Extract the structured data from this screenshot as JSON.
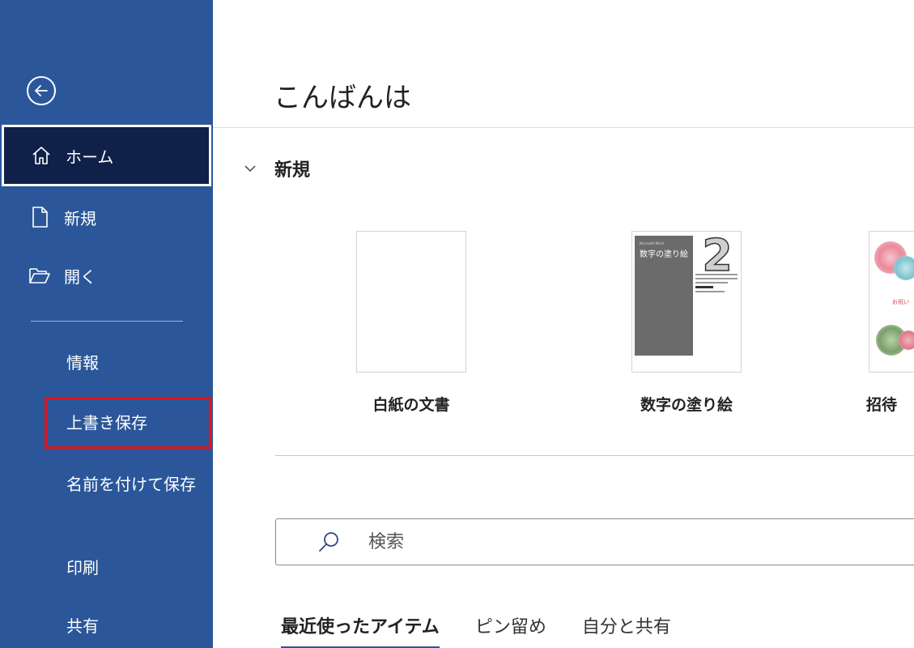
{
  "sidebar": {
    "nav": {
      "home": "ホーム",
      "new": "新規",
      "open": "開く"
    },
    "items": {
      "info": "情報",
      "save": "上書き保存",
      "saveas": "名前を付けて保存",
      "print": "印刷",
      "share": "共有"
    }
  },
  "main": {
    "greeting": "こんばんは",
    "section_new": "新規",
    "templates": {
      "blank": "白紙の文書",
      "coloring": "数字の塗り絵",
      "coloring_thumb_small": "Microsoft Word",
      "coloring_thumb_title": "数字の塗り絵",
      "coloring_thumb_number": "2",
      "invite": "招待",
      "invite_thumb_text": "お祝い"
    },
    "search": {
      "placeholder": "検索"
    },
    "tabs": [
      "最近使ったアイテム",
      "ピン留め",
      "自分と共有"
    ]
  },
  "colors": {
    "sidebar": "#2b579a",
    "home_selected": "#0f2148",
    "save_highlight": "#e0141b",
    "tab_underline": "#2b579a"
  }
}
